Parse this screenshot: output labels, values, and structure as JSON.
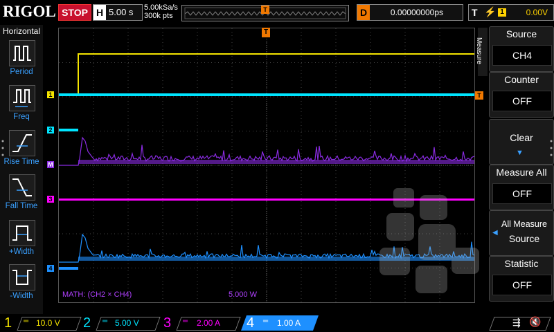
{
  "topbar": {
    "logo": "RIGOL",
    "run_state": "STOP",
    "timebase_label": "H",
    "timebase_value": "5.00 s",
    "sample_rate": "5.00kSa/s",
    "memory_depth": "300k pts",
    "trigger_pos_marker": "T",
    "delay_label": "D",
    "delay_value": "0.00000000ps",
    "trigger_label": "T",
    "trigger_source": "1",
    "trigger_level": "0.00V"
  },
  "left_menu": {
    "title": "Horizontal",
    "items": [
      {
        "label": "Period",
        "icon": "period-icon"
      },
      {
        "label": "Freq",
        "icon": "frequency-icon"
      },
      {
        "label": "Rise Time",
        "icon": "rise-time-icon"
      },
      {
        "label": "Fall Time",
        "icon": "fall-time-icon"
      },
      {
        "label": "+Width",
        "icon": "positive-width-icon"
      },
      {
        "label": "-Width",
        "icon": "negative-width-icon"
      }
    ]
  },
  "screen": {
    "trigger_marker": "T",
    "channel_markers": [
      "1",
      "2",
      "M",
      "3",
      "4"
    ],
    "math_label": "MATH: (CH2 × CH4)",
    "math_scale": "5.000 W",
    "colors": {
      "ch1": "#f5e400",
      "ch2": "#00e5ff",
      "ch3": "#ff00ff",
      "ch4": "#1e90ff",
      "math": "#8a2be2"
    }
  },
  "right_menu": {
    "tab": "Measure",
    "buttons": [
      {
        "title": "Source",
        "value": "CH4"
      },
      {
        "title": "Counter",
        "value": "OFF"
      },
      {
        "title": "Clear",
        "value": ""
      },
      {
        "title": "Measure All",
        "value": "OFF"
      },
      {
        "title": "All Measure",
        "value": "Source"
      },
      {
        "title": "Statistic",
        "value": "OFF"
      }
    ]
  },
  "bottom": {
    "channels": [
      {
        "num": "1",
        "scale": "10.0 V",
        "color": "#f5e400"
      },
      {
        "num": "2",
        "scale": "5.00 V",
        "color": "#00e5ff"
      },
      {
        "num": "3",
        "scale": "2.00 A",
        "color": "#ff00ff"
      },
      {
        "num": "4",
        "scale": "1.00 A",
        "color": "#1e90ff"
      }
    ]
  }
}
